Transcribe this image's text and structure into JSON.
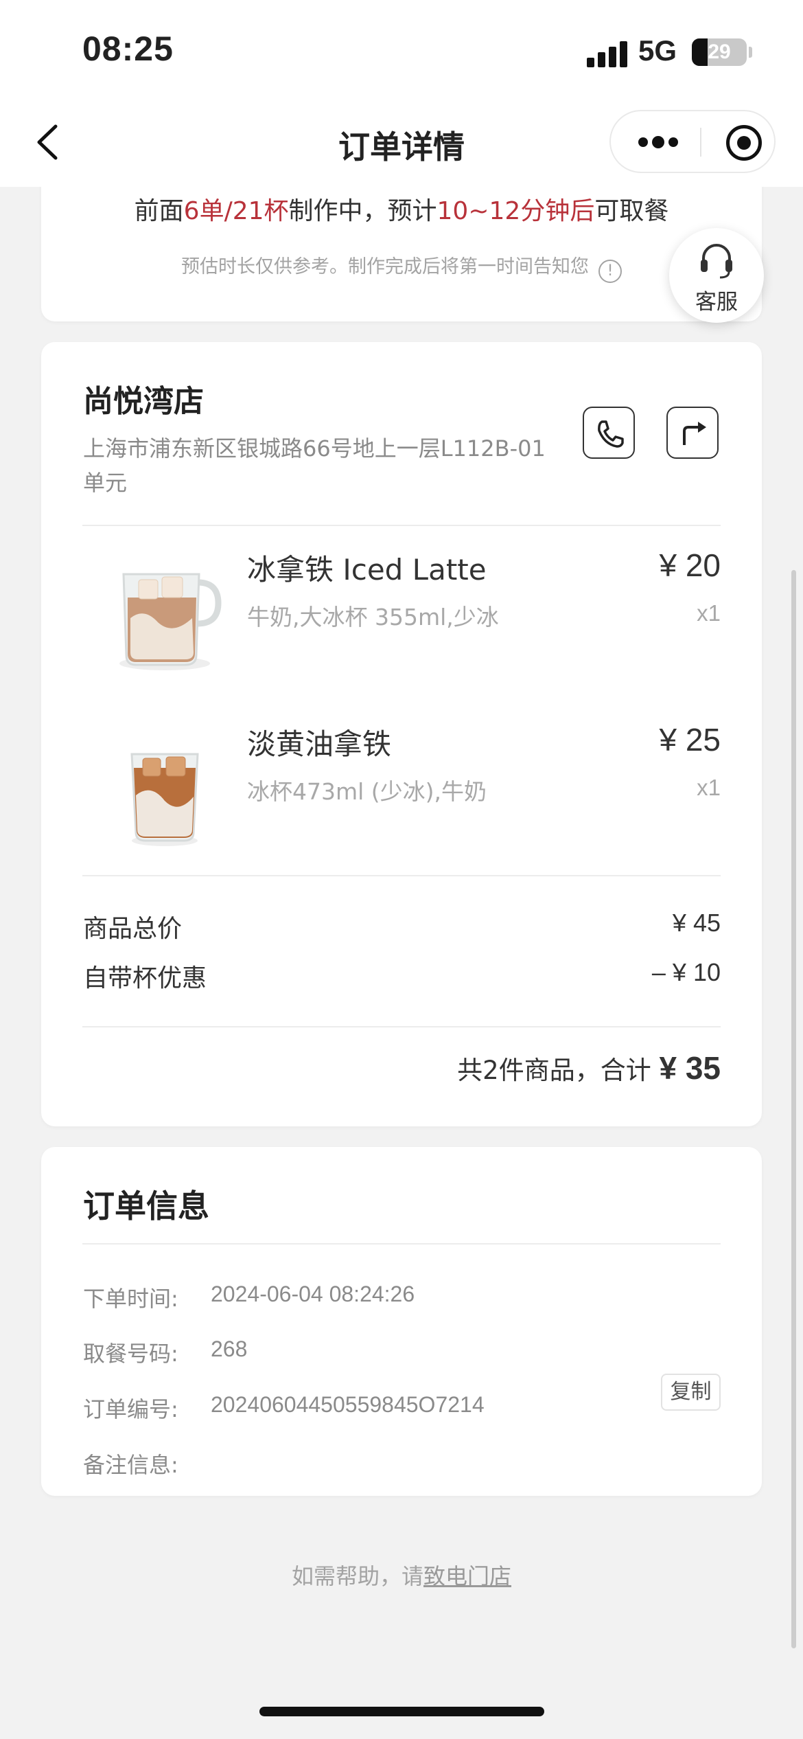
{
  "status_bar": {
    "time": "08:25",
    "network": "5G",
    "battery": "29",
    "battery_level": 0.29
  },
  "navbar": {
    "title": "订单详情"
  },
  "queue": {
    "prefix": "前面",
    "orders": "6单/21杯",
    "middle": "制作中，预计",
    "eta": "10~12分钟后",
    "suffix": "可取餐",
    "note": "预估时长仅供参考。制作完成后将第一时间告知您",
    "info_glyph": "!"
  },
  "service": {
    "label": "客服"
  },
  "store": {
    "name": "尚悦湾店",
    "address_line1": "上海市浦东新区银城路66号地上一层L112B-01",
    "address_line2": "单元"
  },
  "products": [
    {
      "name": "冰拿铁 Iced Latte",
      "spec": "牛奶,大冰杯 355ml,少冰",
      "price": "¥ 20",
      "qty": "x1"
    },
    {
      "name": "淡黄油拿铁",
      "spec": "冰杯473ml (少冰),牛奶",
      "price": "¥ 25",
      "qty": "x1"
    }
  ],
  "summary": {
    "subtotal_label": "商品总价",
    "subtotal_value": "¥ 45",
    "discount_label": "自带杯优惠",
    "discount_value": "–  ¥ 10",
    "total_prefix": "共2件商品，合计 ",
    "total_amount": "¥ 35"
  },
  "order_info": {
    "title": "订单信息",
    "order_time_label": "下单时间:",
    "order_time": "2024-06-04 08:24:26",
    "pickup_label": "取餐号码:",
    "pickup_code": "268",
    "order_no_label": "订单编号:",
    "order_no": "20240604450559845O7214",
    "copy_label": "复制",
    "remark_label": "备注信息:"
  },
  "help": {
    "prefix": "如需帮助，请",
    "link": "致电门店"
  },
  "colors": {
    "accent_red": "#b8323a",
    "background": "#f2f2f2",
    "card": "#ffffff"
  }
}
